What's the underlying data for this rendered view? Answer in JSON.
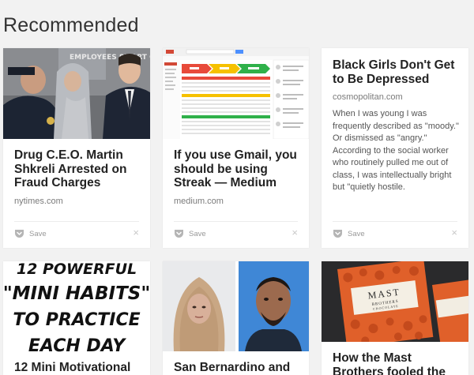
{
  "section": {
    "title": "Recommended"
  },
  "cards": [
    {
      "title": "Drug C.E.O. Martin Shkreli Arrested on Fraud Charges",
      "domain": "nytimes.com",
      "save_label": "Save",
      "dismiss_icon": "×",
      "image_caption": "EMPLOYEES SMART CHOICES"
    },
    {
      "title": "If you use Gmail, you should be using Streak — Medium",
      "domain": "medium.com",
      "save_label": "Save",
      "dismiss_icon": "×"
    },
    {
      "title": "Black Girls Don't Get to Be Depressed",
      "domain": "cosmopolitan.com",
      "excerpt": "When I was young I was frequently described as \"moody.\" Or dismissed as \"angry.\" According to the social worker who routinely pulled me out of class, I was intellectually bright but \"quietly hostile.",
      "save_label": "Save",
      "dismiss_icon": "×"
    },
    {
      "title": "12 Mini Motivational",
      "image_lines": [
        "12 POWERFUL",
        "\"MINI HABITS\"",
        "TO PRACTICE",
        "EACH DAY"
      ]
    },
    {
      "title": "San Bernardino and the"
    },
    {
      "title": "How the Mast Brothers fooled the world into",
      "image_brand": "MAST",
      "image_sub": "BROTHERS",
      "image_label": "CHOCOLATE"
    }
  ],
  "colors": {
    "background": "#f2f2f2",
    "card": "#ffffff",
    "pocket_icon": "#b5b5b5",
    "streak_green": "#2fb14a",
    "streak_yellow": "#f6c100",
    "streak_red": "#e84a3a",
    "mast_orange": "#e0602a"
  }
}
